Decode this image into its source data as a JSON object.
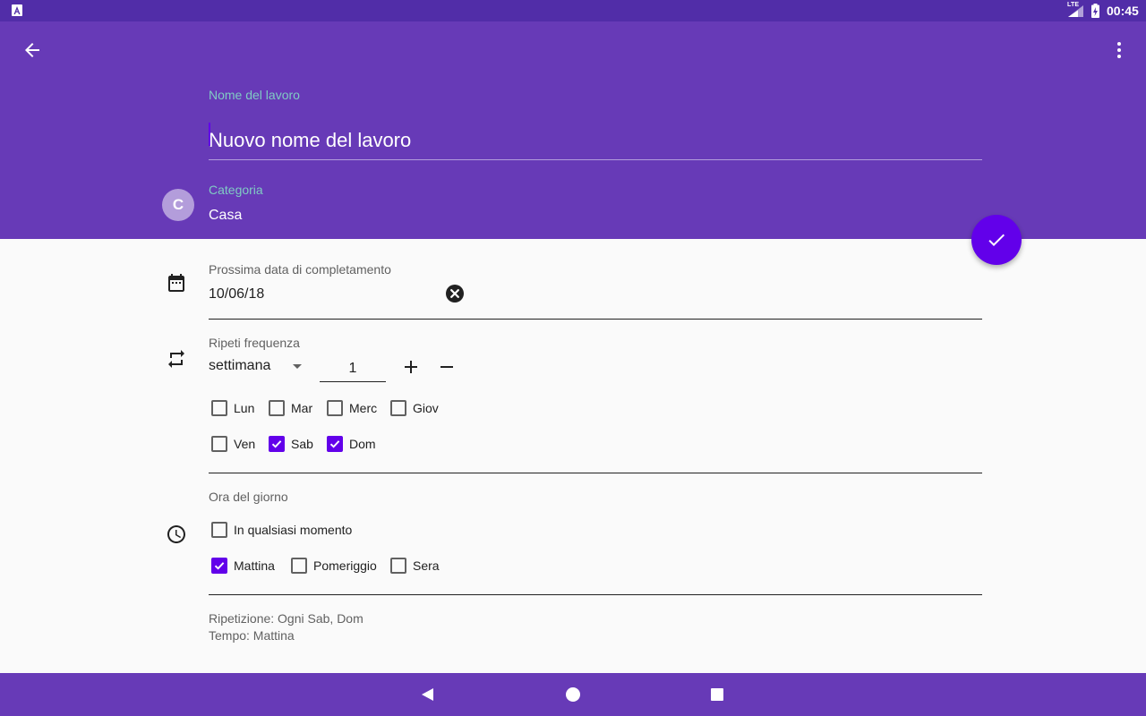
{
  "status_bar": {
    "time": "00:45",
    "network": "LTE"
  },
  "header": {
    "name_label": "Nome del lavoro",
    "name_placeholder": "Nuovo nome del lavoro",
    "category_label": "Categoria",
    "category_initial": "C",
    "category_value": "Casa"
  },
  "completion": {
    "label": "Prossima data di completamento",
    "date": "10/06/18"
  },
  "repeat": {
    "label": "Ripeti frequenza",
    "unit": "settimana",
    "count": "1",
    "days": [
      {
        "label": "Lun",
        "checked": false
      },
      {
        "label": "Mar",
        "checked": false
      },
      {
        "label": "Merc",
        "checked": false
      },
      {
        "label": "Giov",
        "checked": false
      },
      {
        "label": "Ven",
        "checked": false
      },
      {
        "label": "Sab",
        "checked": true
      },
      {
        "label": "Dom",
        "checked": true
      }
    ]
  },
  "time_of_day": {
    "label": "Ora del giorno",
    "options": [
      {
        "label": "In qualsiasi momento",
        "checked": false
      },
      {
        "label": "Mattina",
        "checked": true
      },
      {
        "label": "Pomeriggio",
        "checked": false
      },
      {
        "label": "Sera",
        "checked": false
      }
    ]
  },
  "summary": {
    "repeat_line": "Ripetizione: Ogni Sab, Dom",
    "time_line": "Tempo: Mattina"
  },
  "colors": {
    "status_bar": "#512da8",
    "primary": "#673ab7",
    "accent": "#6200ea",
    "label_teal": "#80cbc4"
  }
}
